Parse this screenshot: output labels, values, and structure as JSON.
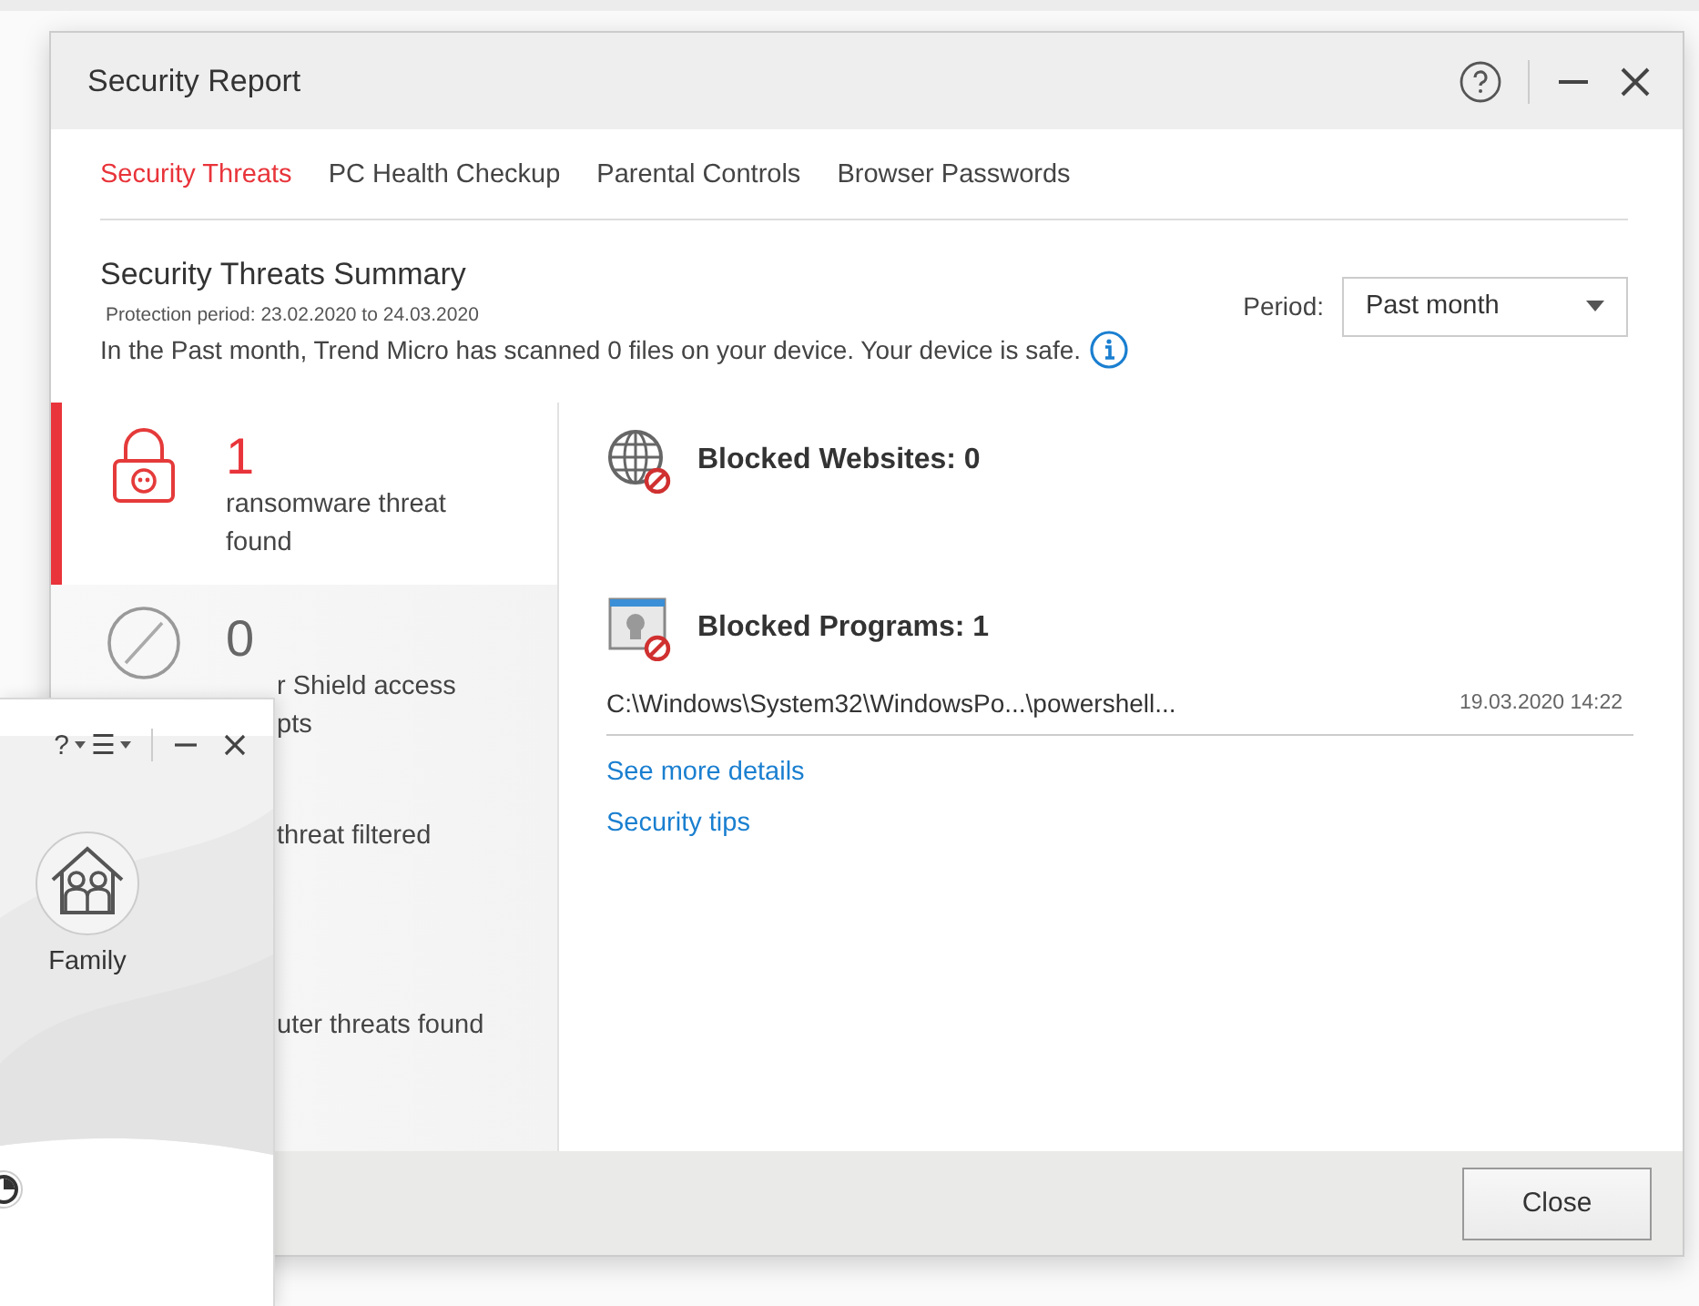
{
  "window": {
    "title": "Security Report"
  },
  "tabs": [
    {
      "label": "Security Threats",
      "selected": true
    },
    {
      "label": "PC Health Checkup",
      "selected": false
    },
    {
      "label": "Parental Controls",
      "selected": false
    },
    {
      "label": "Browser Passwords",
      "selected": false
    }
  ],
  "summary": {
    "title": "Security Threats Summary",
    "period_text": "Protection period: 23.02.2020 to 24.03.2020",
    "message": "In the Past month, Trend Micro has scanned 0 files on your device. Your device is safe.",
    "period_label": "Period:",
    "period_value": "Past month"
  },
  "threat_items": [
    {
      "kind": "lock",
      "count": "1",
      "lines": [
        "ransomware threat",
        "found"
      ],
      "selected": true
    },
    {
      "kind": "blocked",
      "count": "0",
      "lines": [
        "r Shield access",
        "pts"
      ],
      "selected": false
    },
    {
      "lines": [
        "threat filtered"
      ]
    },
    {
      "lines": [
        "uter threats found"
      ]
    }
  ],
  "details": [
    {
      "kind": "globe",
      "title": "Blocked Websites: 0"
    },
    {
      "kind": "program",
      "title": "Blocked Programs: 1",
      "entries": [
        {
          "path": "C:\\Windows\\System32\\WindowsPo...\\powershell...",
          "time": "19.03.2020 14:22"
        }
      ]
    }
  ],
  "links": [
    "See more details",
    "Security tips"
  ],
  "buttons": [
    "Close"
  ],
  "back_window": {
    "help": "?",
    "menu": "☰",
    "tile": "Family"
  }
}
